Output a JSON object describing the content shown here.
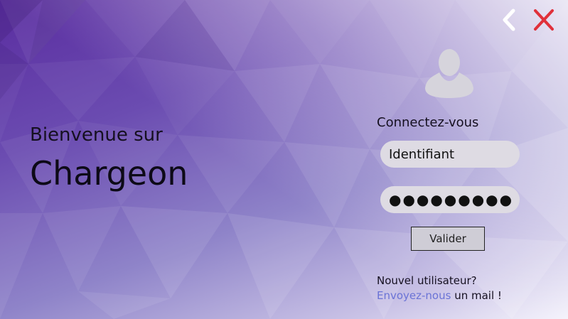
{
  "window": {
    "back_icon": "chevron-left-icon",
    "close_icon": "close-icon",
    "close_color": "#e0303a"
  },
  "welcome": {
    "line1": "Bienvenue sur",
    "brand": "Chargeon"
  },
  "login": {
    "avatar_icon": "user-avatar-icon",
    "title": "Connectez-vous",
    "username_value": "Identifiant",
    "password_value": "●●●●●●●●●●●●",
    "submit_label": "Valider",
    "new_user_text": "Nouvel utilisateur?",
    "mail_link_text": "Envoyez-nous",
    "mail_suffix_text": " un mail !",
    "link_color": "#6a73d6"
  }
}
